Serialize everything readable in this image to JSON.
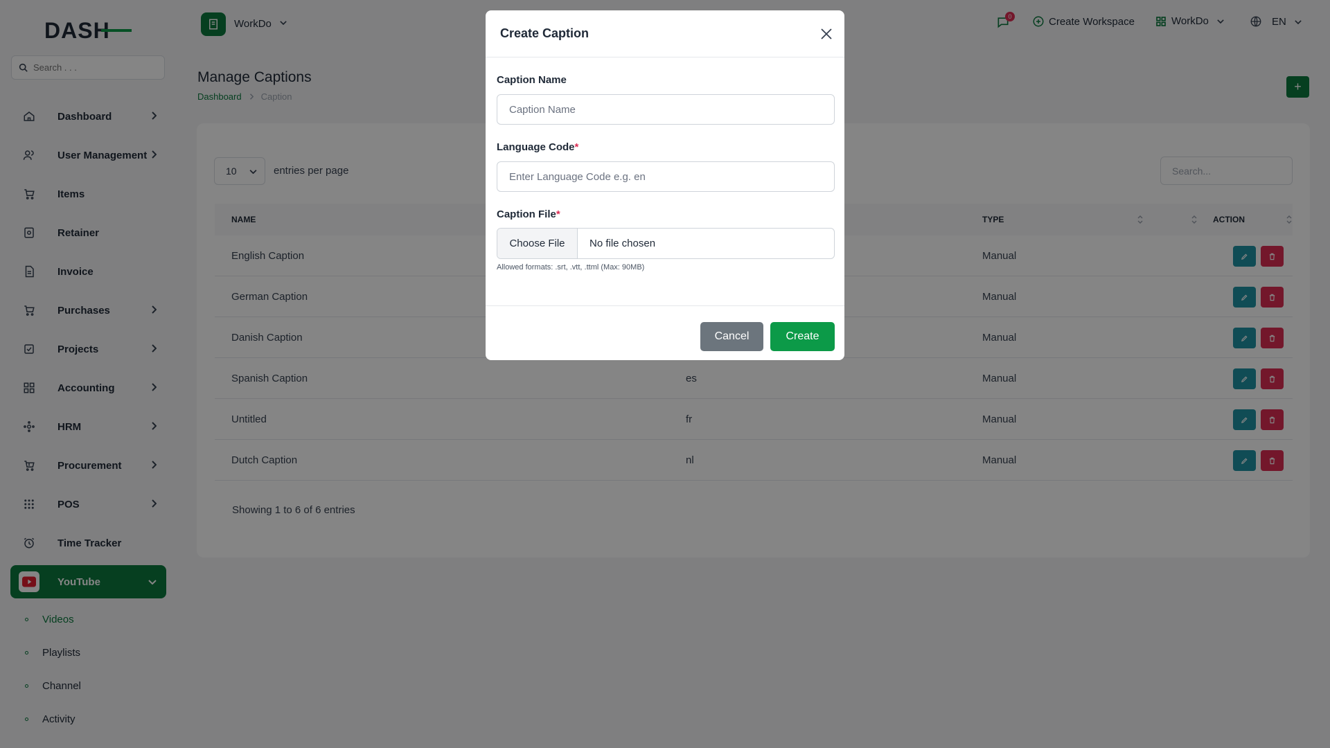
{
  "sidebar": {
    "search_placeholder": "Search . . .",
    "items": [
      {
        "label": "Dashboard",
        "icon": "home-icon",
        "chevron": true
      },
      {
        "label": "User Management",
        "icon": "users-icon",
        "chevron": true
      },
      {
        "label": "Items",
        "icon": "cart-icon",
        "chevron": false
      },
      {
        "label": "Retainer",
        "icon": "retainer-icon",
        "chevron": false
      },
      {
        "label": "Invoice",
        "icon": "invoice-icon",
        "chevron": false
      },
      {
        "label": "Purchases",
        "icon": "cart-icon",
        "chevron": true
      },
      {
        "label": "Projects",
        "icon": "checkbox-icon",
        "chevron": true
      },
      {
        "label": "Accounting",
        "icon": "grid-icon",
        "chevron": true
      },
      {
        "label": "HRM",
        "icon": "hrm-icon",
        "chevron": true
      },
      {
        "label": "Procurement",
        "icon": "procurement-icon",
        "chevron": true
      },
      {
        "label": "POS",
        "icon": "dots-grid-icon",
        "chevron": true
      },
      {
        "label": "Time Tracker",
        "icon": "alarm-icon",
        "chevron": false
      },
      {
        "label": "YouTube",
        "icon": "youtube-icon",
        "chevron": true,
        "active": true
      }
    ],
    "youtube_sub": [
      {
        "label": "Videos",
        "active": true
      },
      {
        "label": "Playlists"
      },
      {
        "label": "Channel"
      },
      {
        "label": "Activity"
      }
    ]
  },
  "header": {
    "workspace": "WorkDo",
    "notification_count": "0",
    "create_workspace": "Create Workspace",
    "workspace_switch": "WorkDo",
    "language": "EN"
  },
  "page": {
    "title": "Manage Captions",
    "breadcrumb": [
      "Dashboard",
      "Caption"
    ]
  },
  "table": {
    "entries_per_page": "10",
    "entries_label": "entries per page",
    "search_placeholder": "Search...",
    "columns": [
      "NAME",
      "TYPE",
      "ACTION"
    ],
    "rows": [
      {
        "name": "English Caption",
        "code": "",
        "type": "Manual"
      },
      {
        "name": "German Caption",
        "code": "",
        "type": "Manual"
      },
      {
        "name": "Danish Caption",
        "code": "",
        "type": "Manual"
      },
      {
        "name": "Spanish Caption",
        "code": "es",
        "type": "Manual"
      },
      {
        "name": "Untitled",
        "code": "fr",
        "type": "Manual"
      },
      {
        "name": "Dutch Caption",
        "code": "nl",
        "type": "Manual"
      }
    ],
    "showing": "Showing 1 to 6 of 6 entries"
  },
  "modal": {
    "title": "Create Caption",
    "caption_name_label": "Caption Name",
    "caption_name_placeholder": "Caption Name",
    "language_code_label": "Language Code",
    "language_code_placeholder": "Enter Language Code e.g. en",
    "caption_file_label": "Caption File",
    "required_mark": "*",
    "choose_file": "Choose File",
    "no_file": "No file chosen",
    "hint": "Allowed formats: .srt, .vtt, .ttml (Max: 90MB)",
    "cancel": "Cancel",
    "create": "Create"
  },
  "colors": {
    "brand": "#0c7a3e",
    "edit": "#1f93a3",
    "delete": "#dc2d54"
  }
}
